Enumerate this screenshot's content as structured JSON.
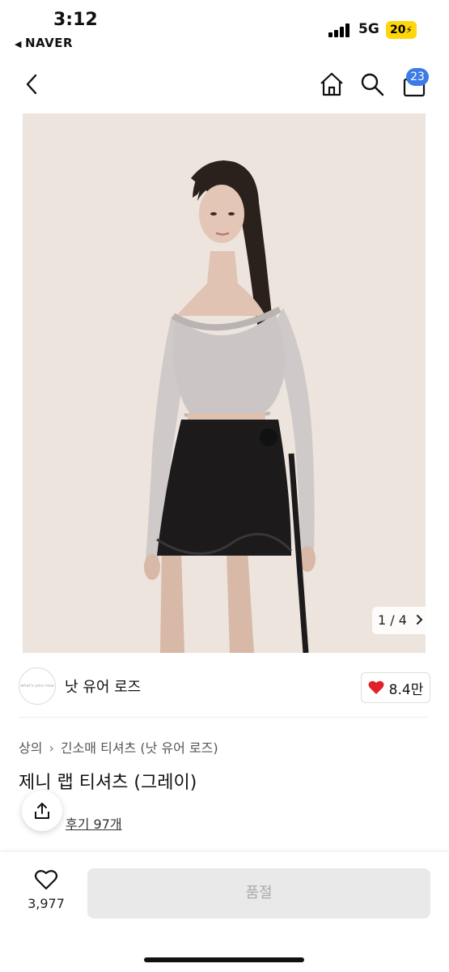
{
  "status_bar": {
    "time": "3:12",
    "back_app": "NAVER",
    "network": "5G",
    "battery": "20"
  },
  "nav": {
    "cart_count": "23"
  },
  "gallery": {
    "pager": "1 / 4"
  },
  "brand": {
    "logo_text": "what's your rose",
    "name": "낫 유어 로즈",
    "likes": "8.4만"
  },
  "product": {
    "breadcrumb": [
      "상의",
      "긴소매 티셔츠 (낫 유어 로즈)"
    ],
    "title": "제니 랩 티셔츠 (그레이)",
    "reviews": "후기 97개"
  },
  "bottom_bar": {
    "wishlist_count": "3,977",
    "soldout_label": "품절"
  },
  "colors": {
    "accent_badge": "#3d7be5",
    "heart": "#e0202a",
    "battery": "#ffd60a"
  },
  "icons": [
    "chevron-left-icon",
    "home-icon",
    "search-icon",
    "shopping-bag-icon",
    "heart-icon",
    "share-icon",
    "chevron-right-icon"
  ]
}
